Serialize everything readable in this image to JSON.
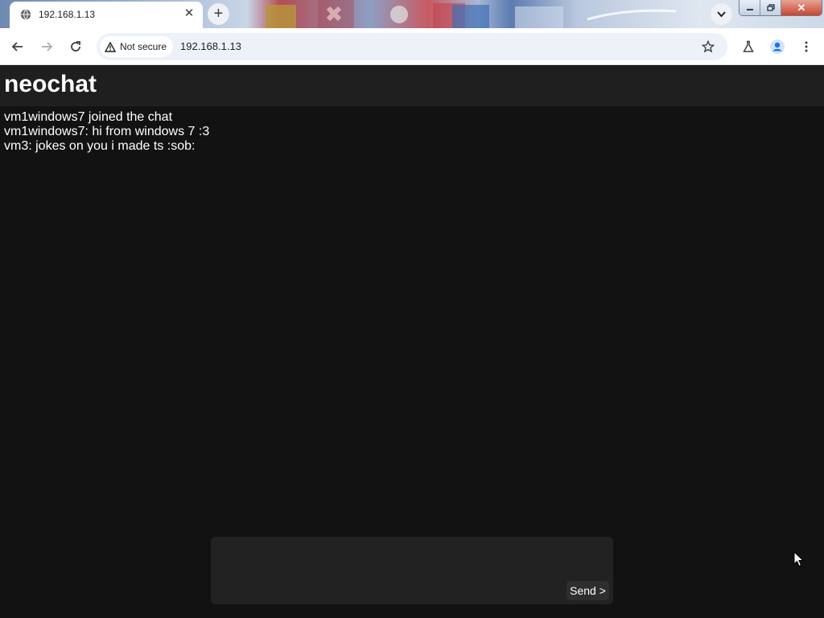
{
  "browser": {
    "tab": {
      "title": "192.168.1.13",
      "close_glyph": "✕",
      "icon": "globe-icon"
    },
    "new_tab_glyph": "+",
    "window_controls": {
      "close_glyph": "✕"
    },
    "address_bar": {
      "security_label": "Not secure",
      "url": "192.168.1.13"
    },
    "icons": [
      "back-icon",
      "forward-icon",
      "reload-icon",
      "warning-icon",
      "star-icon",
      "labs-icon",
      "profile-icon",
      "menu-icon",
      "chevron-down-icon"
    ]
  },
  "app": {
    "title": "neochat",
    "messages": [
      "vm1windows7 joined the chat",
      "vm1windows7: hi from windows 7 :3",
      "vm3: jokes on you i made ts :sob:"
    ],
    "composer": {
      "value": "",
      "send_label": "Send >"
    }
  },
  "colors": {
    "page_background": "#121212",
    "header_background": "#1f1f1f",
    "composer_background": "#222222",
    "text": "#ffffff",
    "omnibox_background": "#edf2fa",
    "profile_accent": "#1a73e8"
  }
}
